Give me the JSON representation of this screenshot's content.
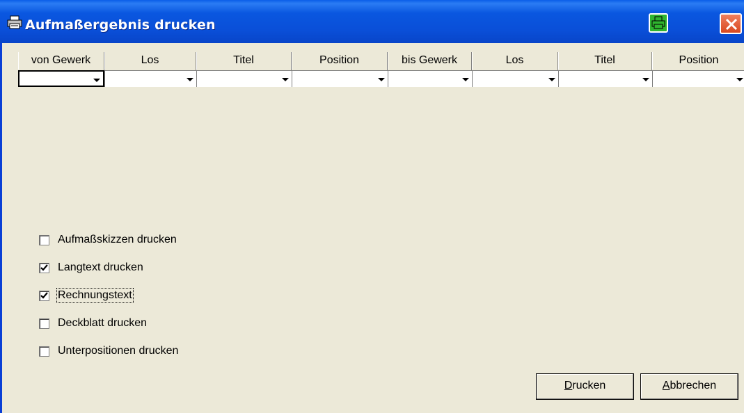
{
  "window": {
    "title": "Aufmaßergebnis drucken",
    "title_icon": "printer-icon",
    "print_icon": "printer-icon",
    "close_icon": "close-icon",
    "accent": "#0a4fd8"
  },
  "grid": {
    "headers": [
      "von Gewerk",
      "Los",
      "Titel",
      "Position",
      "bis Gewerk",
      "Los",
      "Titel",
      "Position"
    ],
    "values": [
      "",
      "",
      "",
      "",
      "",
      "",
      "",
      ""
    ]
  },
  "options": [
    {
      "label": "Aufmaßskizzen drucken",
      "checked": false
    },
    {
      "label": "Langtext drucken",
      "checked": true
    },
    {
      "label": "Rechnungstext",
      "checked": true
    },
    {
      "label": "Deckblatt drucken",
      "checked": false
    },
    {
      "label": "Unterpositionen drucken",
      "checked": false
    }
  ],
  "buttons": {
    "print": {
      "label_accel": "D",
      "label_rest": "rucken"
    },
    "cancel": {
      "label_accel": "A",
      "label_rest": "bbrechen"
    }
  }
}
